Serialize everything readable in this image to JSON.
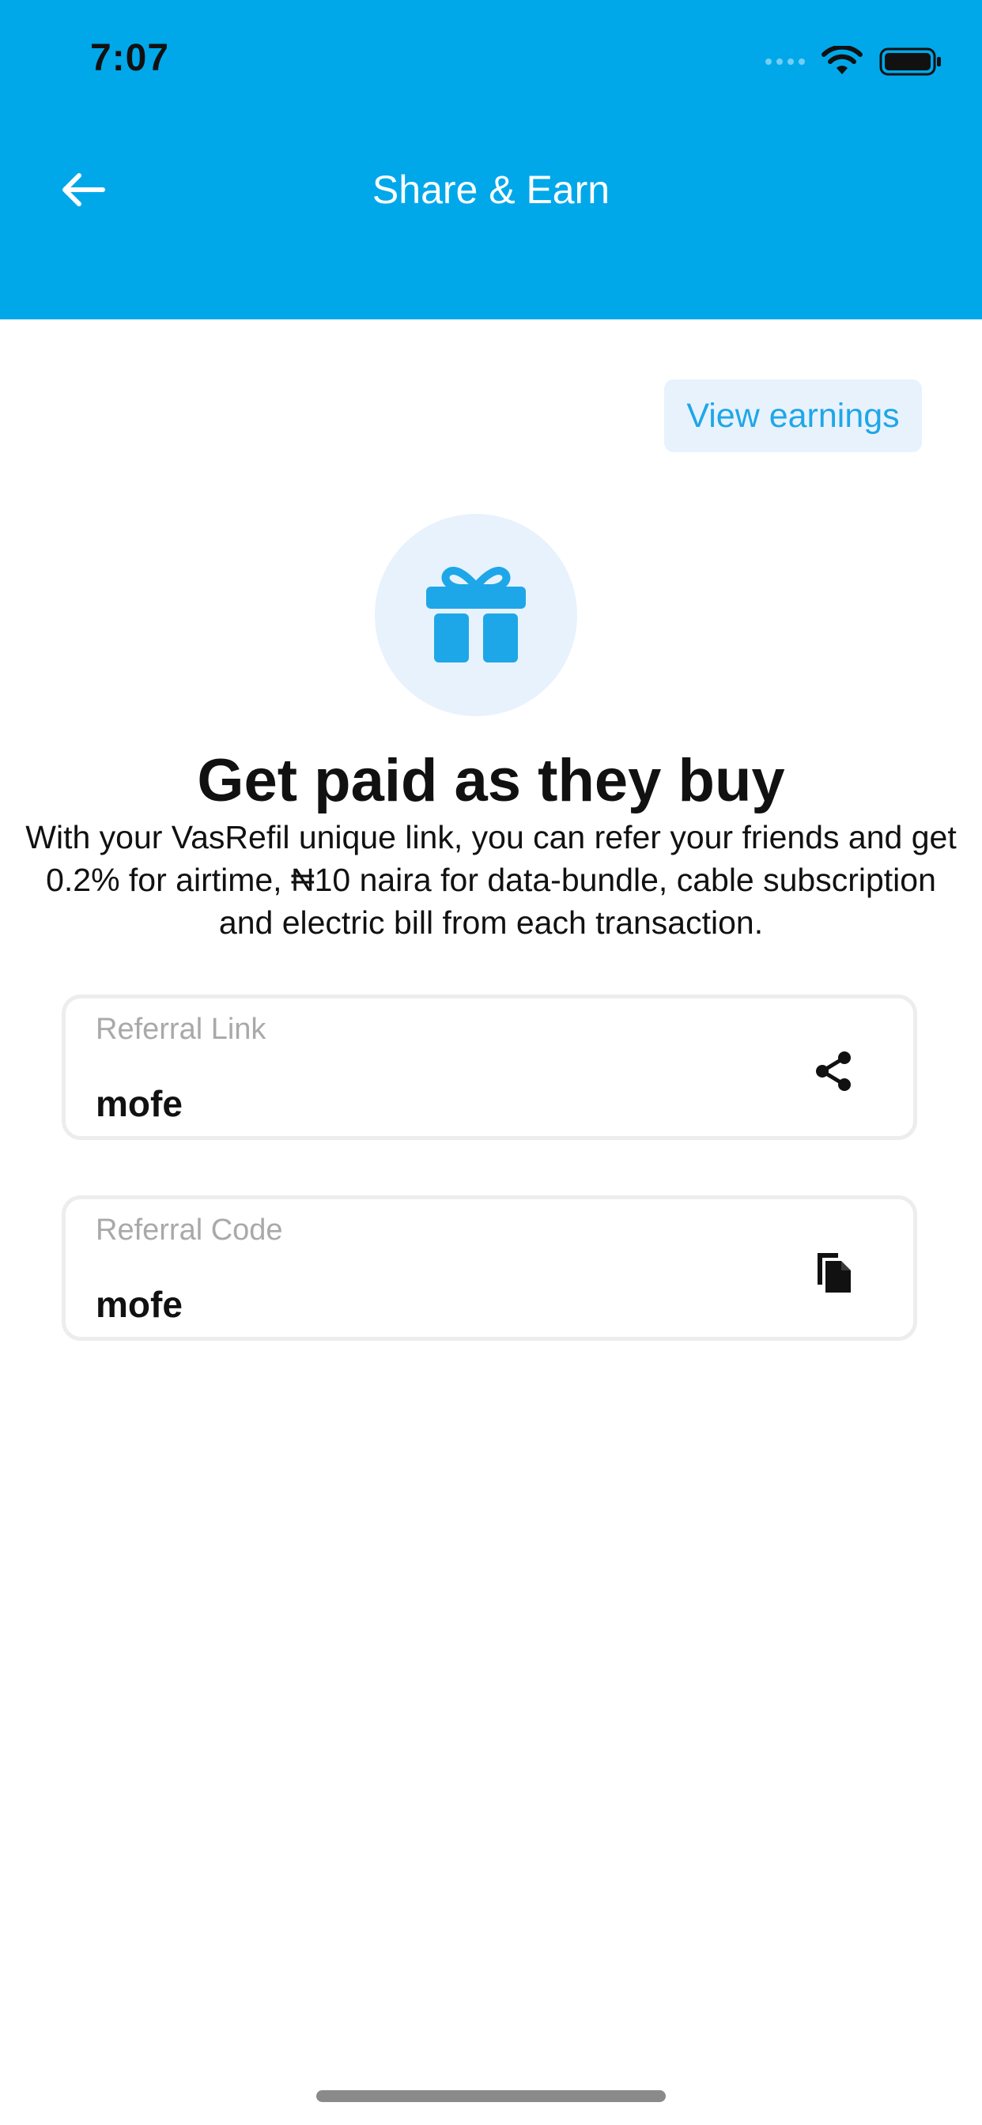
{
  "status_bar": {
    "time": "7:07"
  },
  "header": {
    "title": "Share & Earn"
  },
  "earnings_button": {
    "label": "View earnings"
  },
  "hero": {
    "headline": "Get paid as they buy",
    "description": "With your VasRefil unique link, you can refer your friends and get 0.2% for airtime, ₦10 naira for data-bundle, cable subscription and electric bill from each transaction."
  },
  "referral_link": {
    "label": "Referral Link",
    "value": "mofe",
    "icon": "share-icon"
  },
  "referral_code": {
    "label": "Referral Code",
    "value": "mofe",
    "icon": "copy-icon"
  },
  "colors": {
    "brand": "#00A8EA",
    "accent_bg": "#E8F2FD",
    "accent_text": "#1EA7E8"
  }
}
